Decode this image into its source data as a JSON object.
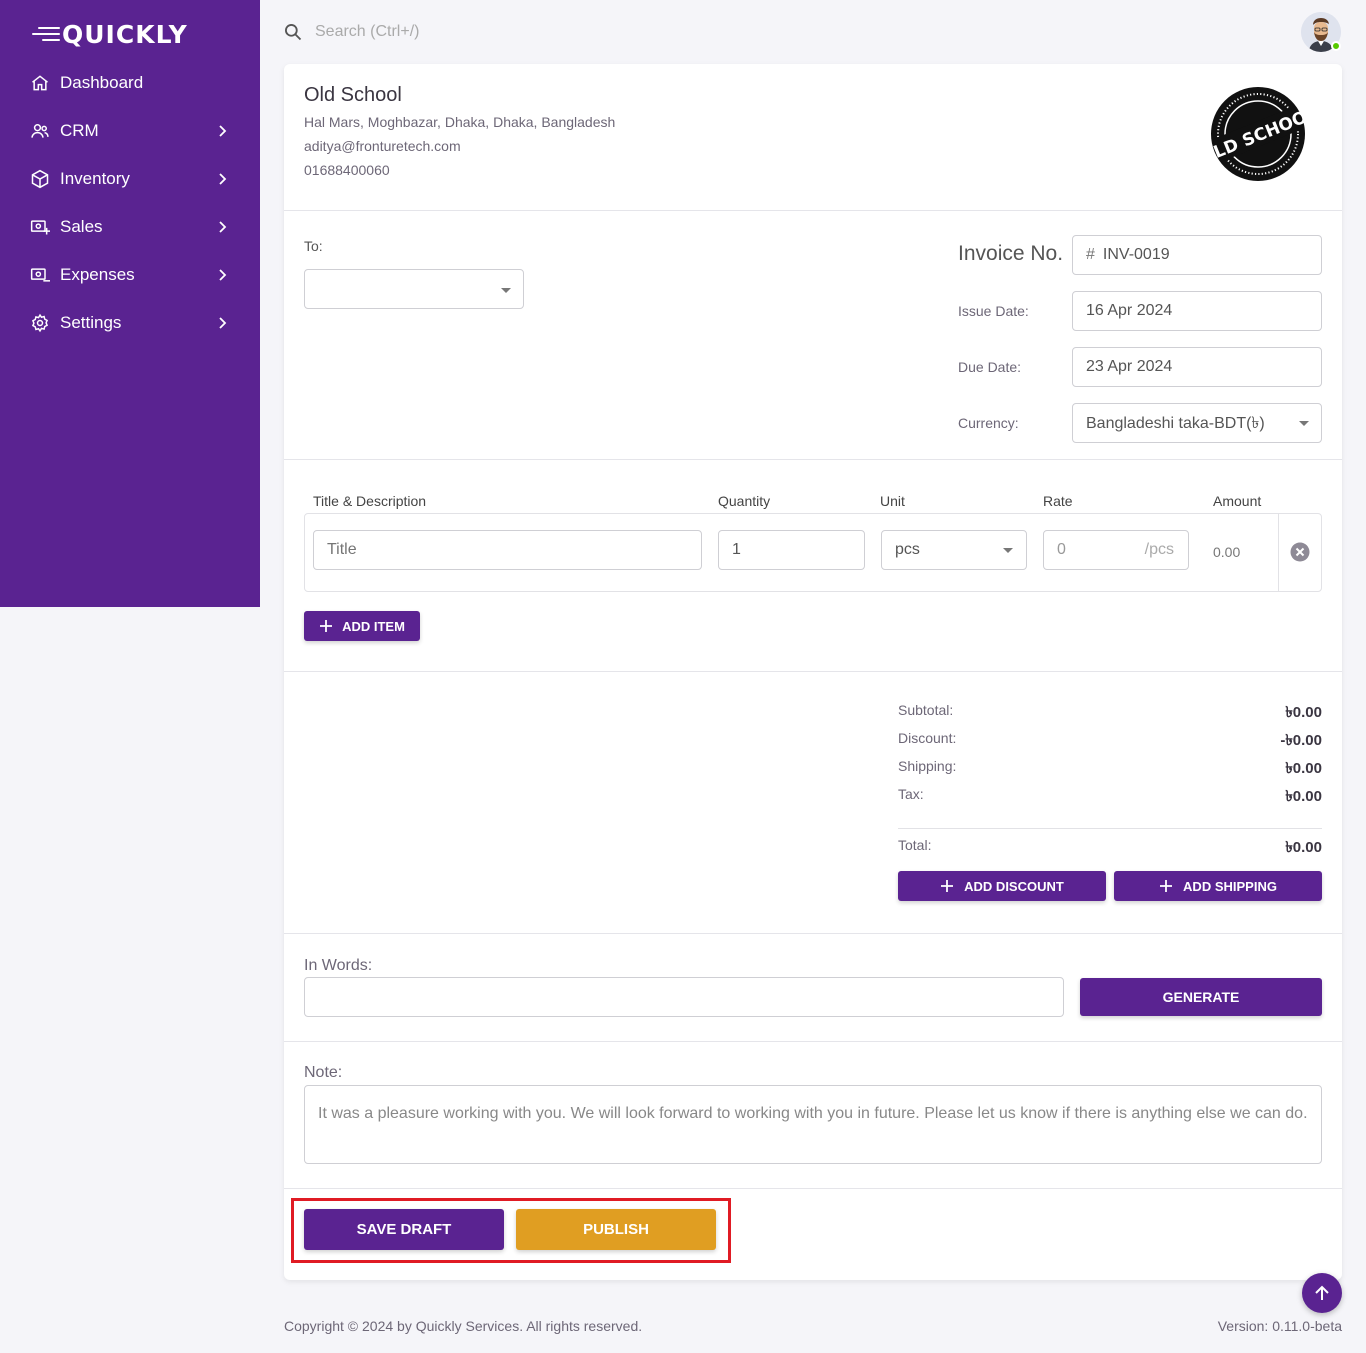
{
  "brand": {
    "logo_text": "QUICKLY"
  },
  "sidebar": {
    "items": [
      {
        "label": "Dashboard",
        "icon": "home-icon",
        "has_children": false
      },
      {
        "label": "CRM",
        "icon": "users-icon",
        "has_children": true
      },
      {
        "label": "Inventory",
        "icon": "box-icon",
        "has_children": true
      },
      {
        "label": "Sales",
        "icon": "cash-plus-icon",
        "has_children": true
      },
      {
        "label": "Expenses",
        "icon": "cash-minus-icon",
        "has_children": true
      },
      {
        "label": "Settings",
        "icon": "gear-icon",
        "has_children": true
      }
    ]
  },
  "topbar": {
    "search_placeholder": "Search (Ctrl+/)",
    "avatar_status": "online"
  },
  "company": {
    "name": "Old School",
    "address": "Hal Mars, Moghbazar, Dhaka, Dhaka, Bangladesh",
    "email": "aditya@fronturetech.com",
    "phone": "01688400060",
    "seal_text": "OLD SCHOOL"
  },
  "invoice": {
    "to_label": "To:",
    "to_value": "",
    "number_label": "Invoice No.",
    "number_prefix": "#",
    "number_value": "INV-0019",
    "issue_date_label": "Issue Date:",
    "issue_date": "16 Apr 2024",
    "due_date_label": "Due Date:",
    "due_date": "23 Apr 2024",
    "currency_label": "Currency:",
    "currency": "Bangladeshi taka-BDT(৳)"
  },
  "items_table": {
    "headers": [
      "Title & Description",
      "Quantity",
      "Unit",
      "Rate",
      "Amount"
    ],
    "rows": [
      {
        "title_placeholder": "Title",
        "quantity": "1",
        "unit": "pcs",
        "rate_placeholder": "0",
        "rate_suffix": "/pcs",
        "amount": "0.00"
      }
    ],
    "add_item_label": "ADD ITEM"
  },
  "summary": {
    "subtotal_label": "Subtotal:",
    "subtotal": "৳0.00",
    "discount_label": "Discount:",
    "discount": "-৳0.00",
    "shipping_label": "Shipping:",
    "shipping": "৳0.00",
    "tax_label": "Tax:",
    "tax": "৳0.00",
    "total_label": "Total:",
    "total": "৳0.00",
    "add_discount_label": "ADD DISCOUNT",
    "add_shipping_label": "ADD SHIPPING"
  },
  "in_words": {
    "label": "In Words:",
    "value": "",
    "generate_label": "GENERATE"
  },
  "note": {
    "label": "Note:",
    "text": "It was a pleasure working with you. We will look forward to working with you in future. Please let us know if there is anything else we can do."
  },
  "actions": {
    "save_draft_label": "SAVE DRAFT",
    "publish_label": "PUBLISH"
  },
  "footer": {
    "copyright": "Copyright © 2024 by Quickly Services. All rights reserved.",
    "version": "Version: 0.11.0-beta"
  },
  "colors": {
    "brand_purple": "#5a2391",
    "publish_yellow": "#e09e22",
    "highlight_red": "#e01b24"
  }
}
